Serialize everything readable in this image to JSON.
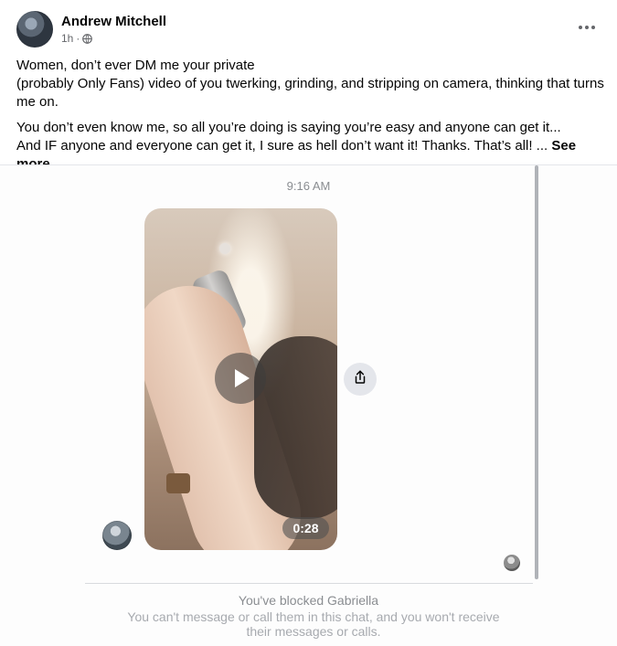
{
  "post": {
    "author": "Andrew Mitchell",
    "time": "1h",
    "meta_separator": "·",
    "privacy_icon": "globe-icon",
    "more_icon": "more-horizontal-icon",
    "text": {
      "p1_line1": "Women, don’t ever DM me your private",
      "p1_line2": "(probably Only Fans) video of you twerking, grinding, and stripping on camera, thinking that turns me on.",
      "p2_line1": "You don’t even know me, so all you’re doing is saying you’re easy and anyone can get it...",
      "p2_line2": "And IF anyone and everyone can get it, I sure as hell don’t want it! Thanks. That’s all! ...",
      "see_more": "See more"
    }
  },
  "screenshot": {
    "chat_time": "9:16 AM",
    "video_duration": "0:28",
    "play_icon": "play-icon",
    "share_icon": "share-icon",
    "blocked_title": "You've blocked Gabriella",
    "blocked_desc_line1": "You can't message or call them in this chat, and you won't receive",
    "blocked_desc_line2": "their messages or calls."
  },
  "colors": {
    "text_primary": "#050505",
    "text_secondary": "#65676b",
    "muted": "#8a8d91",
    "divider": "#e4e6eb"
  }
}
